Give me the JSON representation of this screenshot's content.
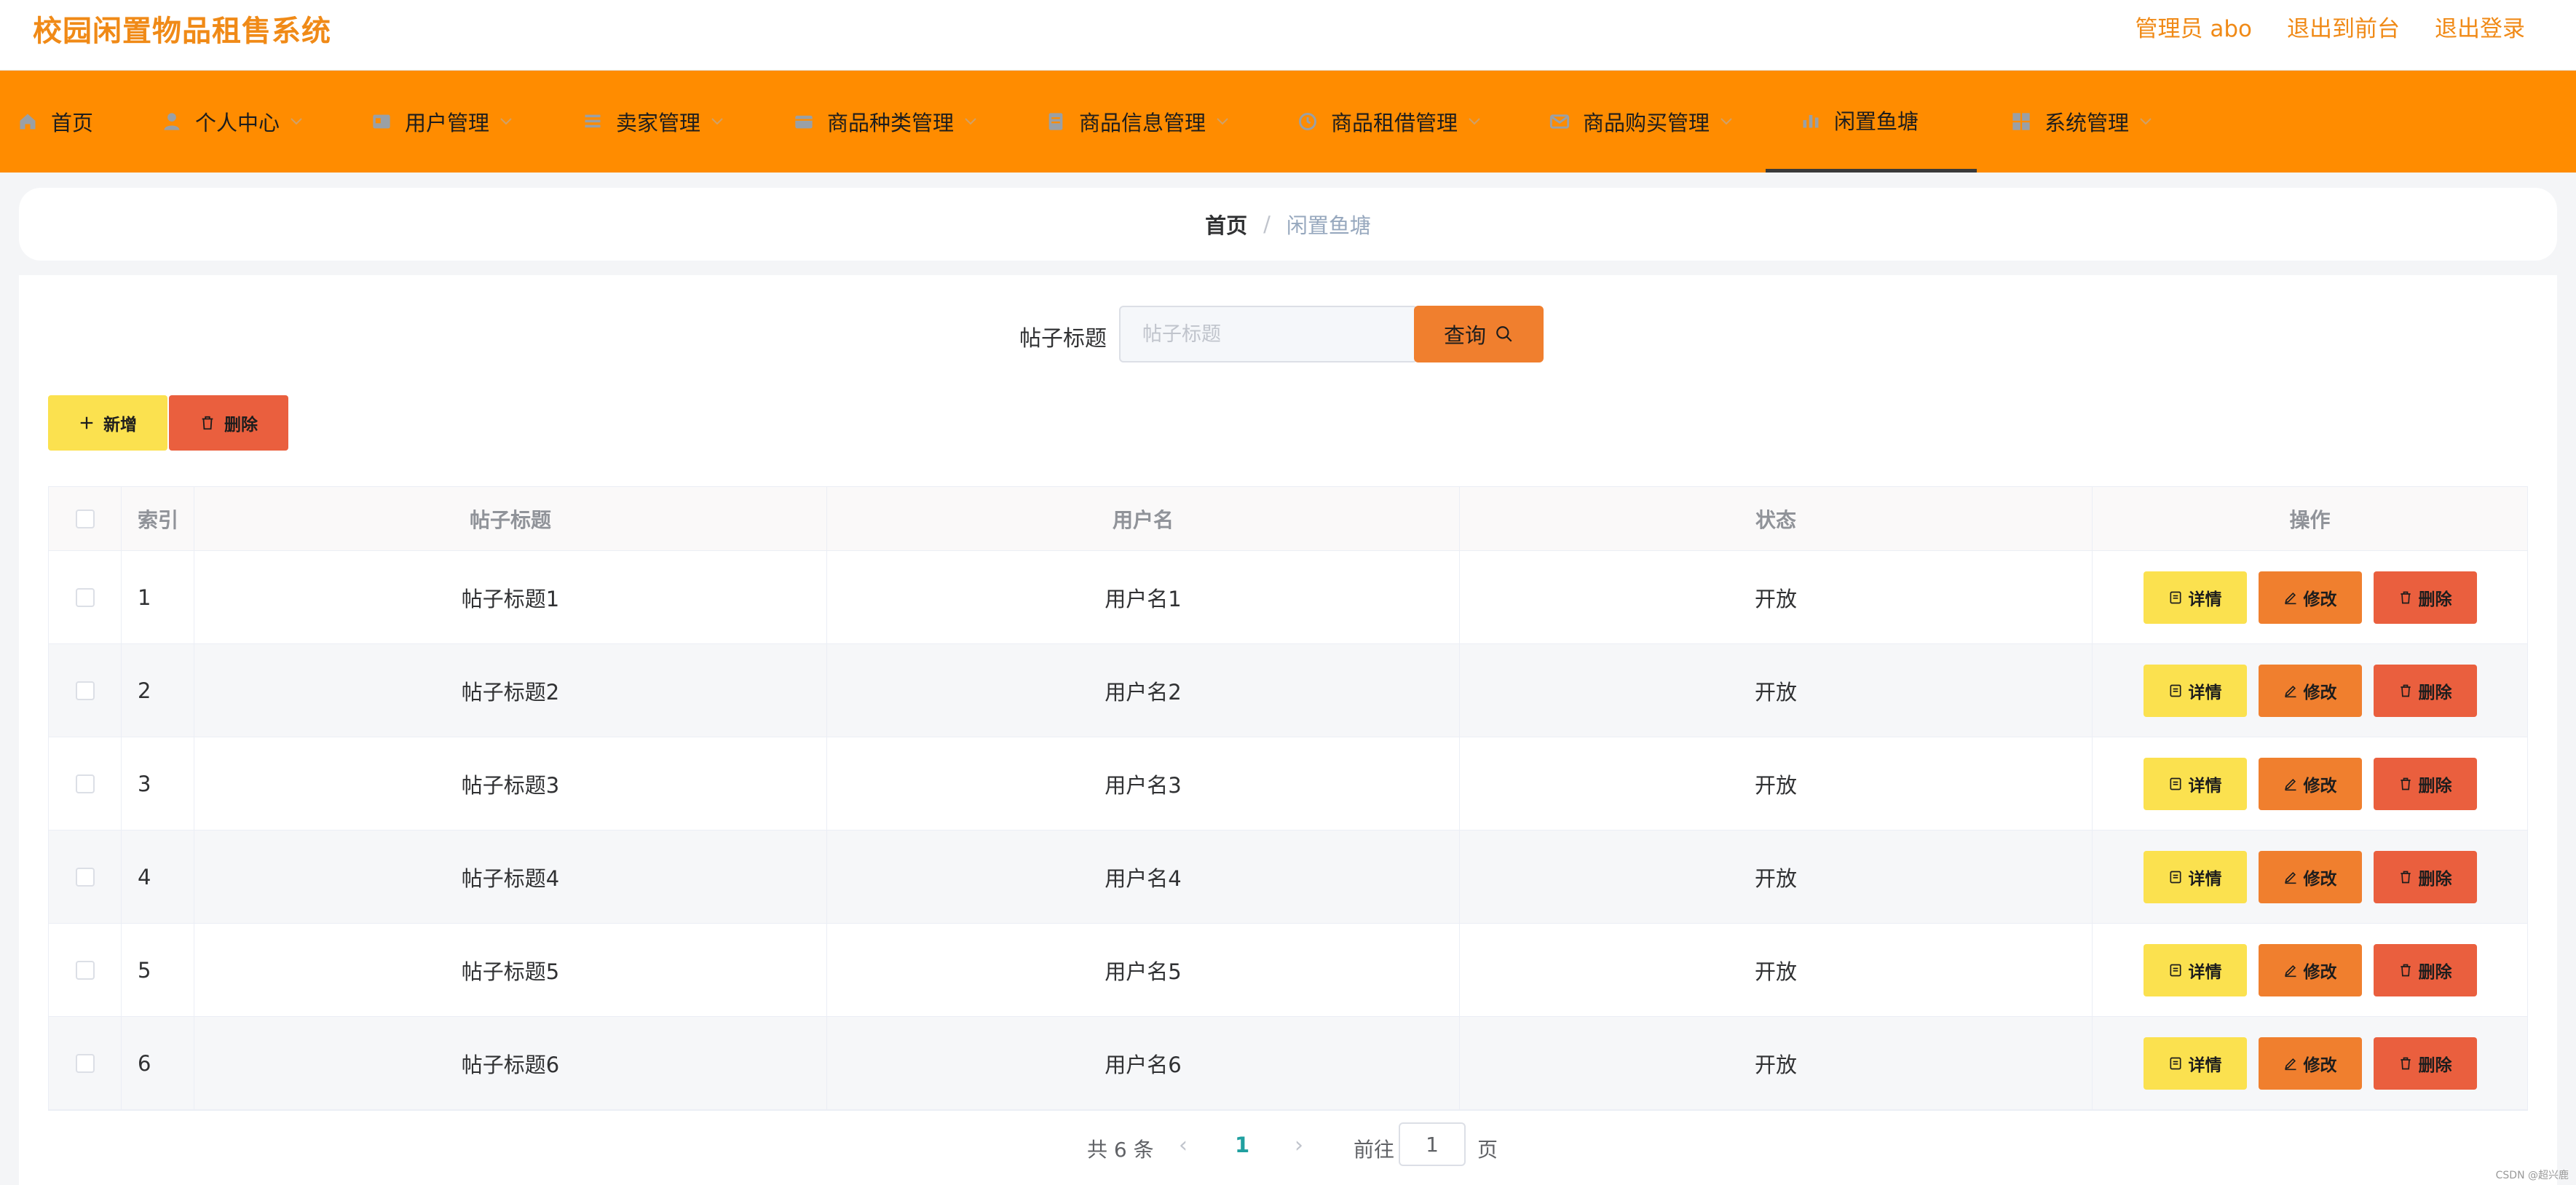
{
  "header": {
    "title": "校园闲置物品租售系统",
    "admin_label": "管理员 abo",
    "front_label": "退出到前台",
    "logout_label": "退出登录"
  },
  "nav": {
    "items": [
      {
        "label": "首页",
        "icon": "home-icon"
      },
      {
        "label": "个人中心",
        "icon": "person-icon"
      },
      {
        "label": "用户管理",
        "icon": "user-card-icon"
      },
      {
        "label": "卖家管理",
        "icon": "list-icon"
      },
      {
        "label": "商品种类管理",
        "icon": "box-icon"
      },
      {
        "label": "商品信息管理",
        "icon": "document-icon"
      },
      {
        "label": "商品租借管理",
        "icon": "clock-icon"
      },
      {
        "label": "商品购买管理",
        "icon": "mail-icon"
      },
      {
        "label": "闲置鱼塘",
        "icon": "chart-icon"
      },
      {
        "label": "系统管理",
        "icon": "grid-icon"
      }
    ]
  },
  "breadcrumb": {
    "home": "首页",
    "separator": "/",
    "current": "闲置鱼塘"
  },
  "search": {
    "label": "帖子标题",
    "placeholder": "帖子标题",
    "button": "查询"
  },
  "actions": {
    "add": "新增",
    "delete": "删除"
  },
  "table": {
    "headers": [
      "索引",
      "帖子标题",
      "用户名",
      "状态",
      "操作"
    ],
    "rows": [
      {
        "index": "1",
        "title": "帖子标题1",
        "user": "用户名1",
        "status": "开放"
      },
      {
        "index": "2",
        "title": "帖子标题2",
        "user": "用户名2",
        "status": "开放"
      },
      {
        "index": "3",
        "title": "帖子标题3",
        "user": "用户名3",
        "status": "开放"
      },
      {
        "index": "4",
        "title": "帖子标题4",
        "user": "用户名4",
        "status": "开放"
      },
      {
        "index": "5",
        "title": "帖子标题5",
        "user": "用户名5",
        "status": "开放"
      },
      {
        "index": "6",
        "title": "帖子标题6",
        "user": "用户名6",
        "status": "开放"
      }
    ],
    "op_labels": {
      "detail": "详情",
      "edit": "修改",
      "delete": "删除"
    }
  },
  "pagination": {
    "total": "共 6 条",
    "prev": "‹",
    "current_page": "1",
    "next": "›",
    "goto": "前往",
    "jump_value": "1",
    "unit": "页"
  },
  "watermark": "CSDN @超兴鹿",
  "colors": {
    "brand": "#f08a17",
    "nav_bg": "#ff8c00",
    "add_btn": "#fbe14f",
    "edit_btn": "#f07f2e",
    "delete_btn": "#ea5f3e",
    "active_page": "#20a0a0"
  }
}
